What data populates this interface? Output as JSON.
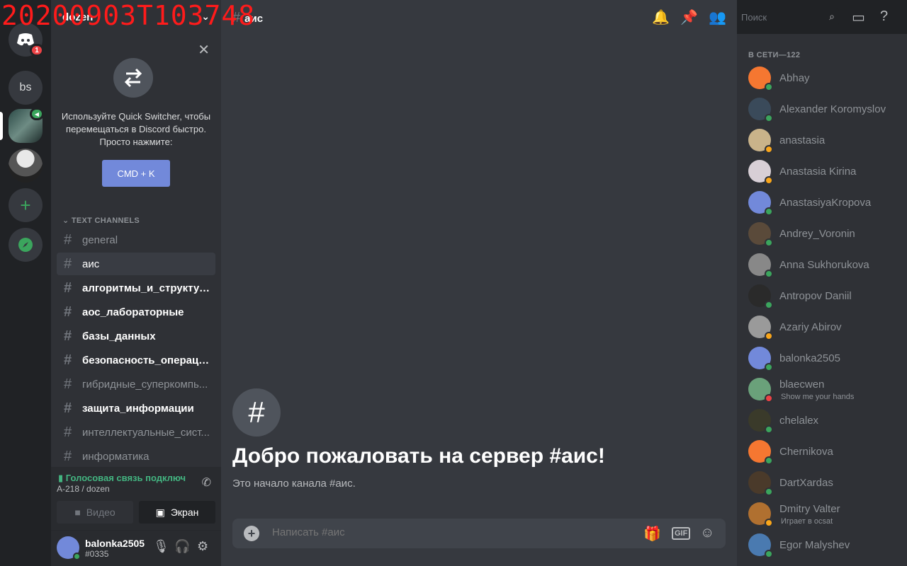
{
  "stamp": "20200903T103748",
  "colors": {
    "blurple": "#7289da",
    "online": "#3ba55d",
    "idle": "#faa61a",
    "dnd": "#ed4245",
    "voice": "#43b581"
  },
  "rail": {
    "home_badge": "1",
    "server_bs": "bs"
  },
  "server": {
    "name": "dozen"
  },
  "quick_switcher": {
    "text": "Используйте Quick Switcher, чтобы перемещаться в Discord быстро. Просто нажмите:",
    "button": "CMD + K"
  },
  "channels": {
    "category": "TEXT CHANNELS",
    "items": [
      {
        "name": "general",
        "state": "muted"
      },
      {
        "name": "аис",
        "state": "selected"
      },
      {
        "name": "алгоритмы_и_структур...",
        "state": "unread"
      },
      {
        "name": "аос_лабораторные",
        "state": "unread"
      },
      {
        "name": "базы_данных",
        "state": "unread"
      },
      {
        "name": "безопасность_операци...",
        "state": "unread"
      },
      {
        "name": "гибридные_суперкомпь...",
        "state": "muted"
      },
      {
        "name": "защита_информации",
        "state": "unread"
      },
      {
        "name": "интеллектуальные_сист...",
        "state": "muted"
      },
      {
        "name": "информатика",
        "state": "muted"
      }
    ]
  },
  "voice": {
    "status": "Голосовая связь подключ",
    "location": "A-218 / dozen",
    "video": "Видео",
    "screen": "Экран"
  },
  "user": {
    "name": "balonka2505",
    "tag": "#0335"
  },
  "chat": {
    "channel": "аис",
    "welcome_title": "Добро пожаловать на сервер #аис!",
    "welcome_sub": "Это начало канала #аис.",
    "placeholder": "Написать #аис",
    "gif": "GIF"
  },
  "topbar": {
    "search_placeholder": "Поиск"
  },
  "members": {
    "header": "В СЕТИ—122",
    "list": [
      {
        "name": "Abhay",
        "status": "online",
        "avatar": "#f57731"
      },
      {
        "name": "Alexander Koromyslov",
        "status": "online",
        "avatar": "#3a4a5a"
      },
      {
        "name": "anastasia",
        "status": "idle",
        "avatar": "#c9b38a"
      },
      {
        "name": "Anastasia Kirina",
        "status": "idle",
        "avatar": "#d8cfd6"
      },
      {
        "name": "AnastasiyaKropova",
        "status": "online",
        "avatar": "#7289da"
      },
      {
        "name": "Andrey_Voronin",
        "status": "online",
        "avatar": "#5a4a3a"
      },
      {
        "name": "Anna Sukhorukova",
        "status": "online",
        "avatar": "#888888"
      },
      {
        "name": "Antropov Daniil",
        "status": "online",
        "avatar": "#2a2a2a"
      },
      {
        "name": "Azariy Abirov",
        "status": "idle",
        "avatar": "#9a9a9a"
      },
      {
        "name": "balonka2505",
        "status": "online",
        "avatar": "#7289da"
      },
      {
        "name": "blaecwen",
        "status": "dnd",
        "avatar": "#6aa17a",
        "sub": "Show me your hands"
      },
      {
        "name": "chelalex",
        "status": "online",
        "avatar": "#3a3a2a"
      },
      {
        "name": "Chernikova",
        "status": "online",
        "avatar": "#f57731"
      },
      {
        "name": "DartXardas",
        "status": "online",
        "avatar": "#4a3a2a"
      },
      {
        "name": "Dmitry Valter",
        "status": "idle",
        "avatar": "#b07030",
        "sub": "Играет в ocsat"
      },
      {
        "name": "Egor Malyshev",
        "status": "online",
        "avatar": "#4a7ab0"
      }
    ]
  }
}
